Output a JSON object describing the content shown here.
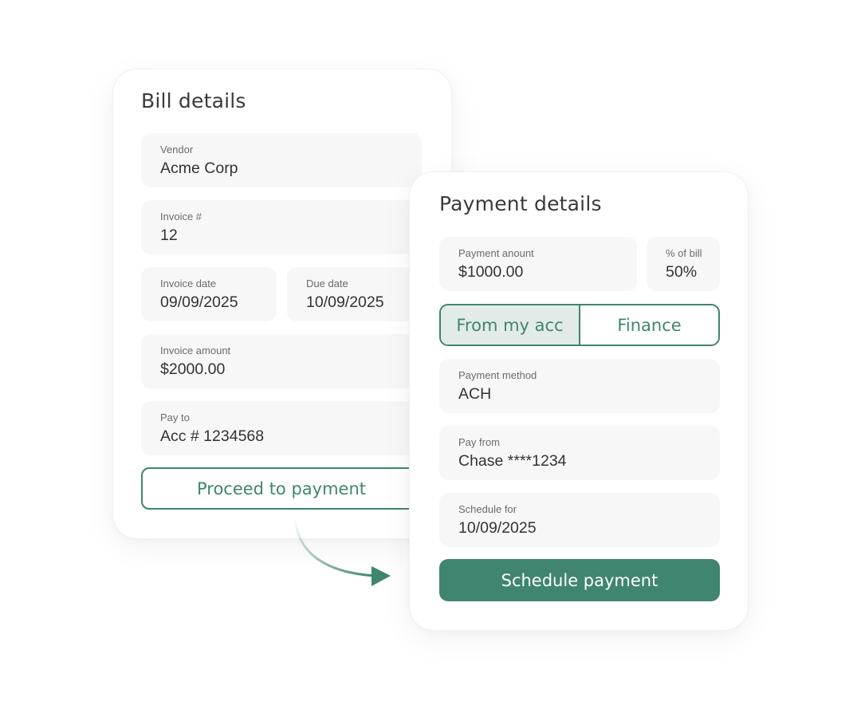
{
  "bill": {
    "title": "Bill details",
    "vendor": {
      "label": "Vendor",
      "value": "Acme Corp"
    },
    "invoice_number": {
      "label": "Invoice #",
      "value": "12"
    },
    "invoice_date": {
      "label": "Invoice date",
      "value": "09/09/2025"
    },
    "due_date": {
      "label": "Due date",
      "value": "10/09/2025"
    },
    "invoice_amount": {
      "label": "Invoice amount",
      "value": "$2000.00"
    },
    "pay_to": {
      "label": "Pay to",
      "value": "Acc # 1234568"
    },
    "proceed_label": "Proceed to payment"
  },
  "payment": {
    "title": "Payment details",
    "amount": {
      "label": "Payment anount",
      "value": "$1000.00"
    },
    "percent": {
      "label": "% of bill",
      "value": "50%"
    },
    "toggle": {
      "options": [
        "From my acc",
        "Finance"
      ],
      "selected": "From my acc"
    },
    "method": {
      "label": "Payment method",
      "value": "ACH"
    },
    "pay_from": {
      "label": "Pay from",
      "value": "Chase ****1234"
    },
    "schedule_for": {
      "label": "Schedule for",
      "value": "10/09/2025"
    },
    "schedule_label": "Schedule payment"
  },
  "colors": {
    "accent": "#3f8570",
    "accent_light": "#e2ebe7",
    "field_bg": "#f7f7f7"
  }
}
